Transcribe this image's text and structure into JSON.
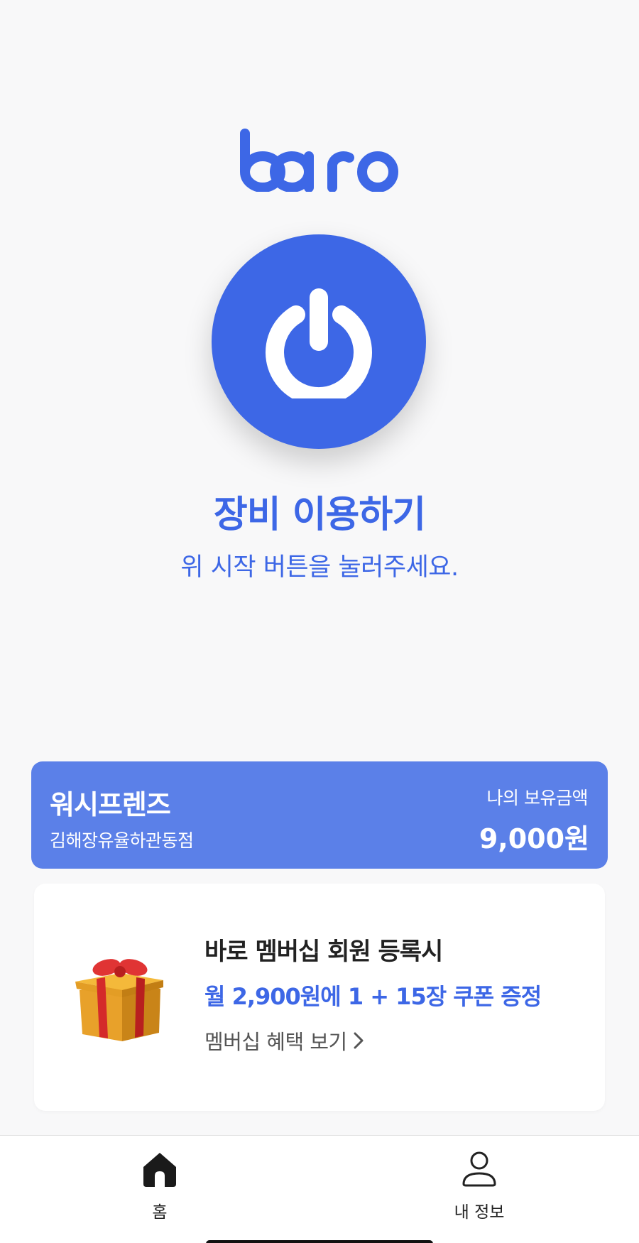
{
  "brand": {
    "logo_text": "baro",
    "accent_color": "#3d67e6",
    "card_color": "#5b80e8"
  },
  "main": {
    "power_icon": "power-icon",
    "title": "장비 이용하기",
    "subtitle": "위 시작 버튼을 눌러주세요."
  },
  "store_card": {
    "name": "워시프렌즈",
    "branch": "김해장유율하관동점",
    "balance_label": "나의 보유금액",
    "balance_value": "9,000원"
  },
  "promo": {
    "icon": "gift-icon",
    "title": "바로 멤버십 회원 등록시",
    "offer": "월 2,900원에 1 + 15장 쿠폰 증정",
    "link_label": "멤버십 혜택 보기",
    "link_icon": "chevron-right-icon"
  },
  "bottom_nav": {
    "items": [
      {
        "label": "홈",
        "icon": "home-icon",
        "active": true
      },
      {
        "label": "내 정보",
        "icon": "user-icon",
        "active": false
      }
    ]
  }
}
